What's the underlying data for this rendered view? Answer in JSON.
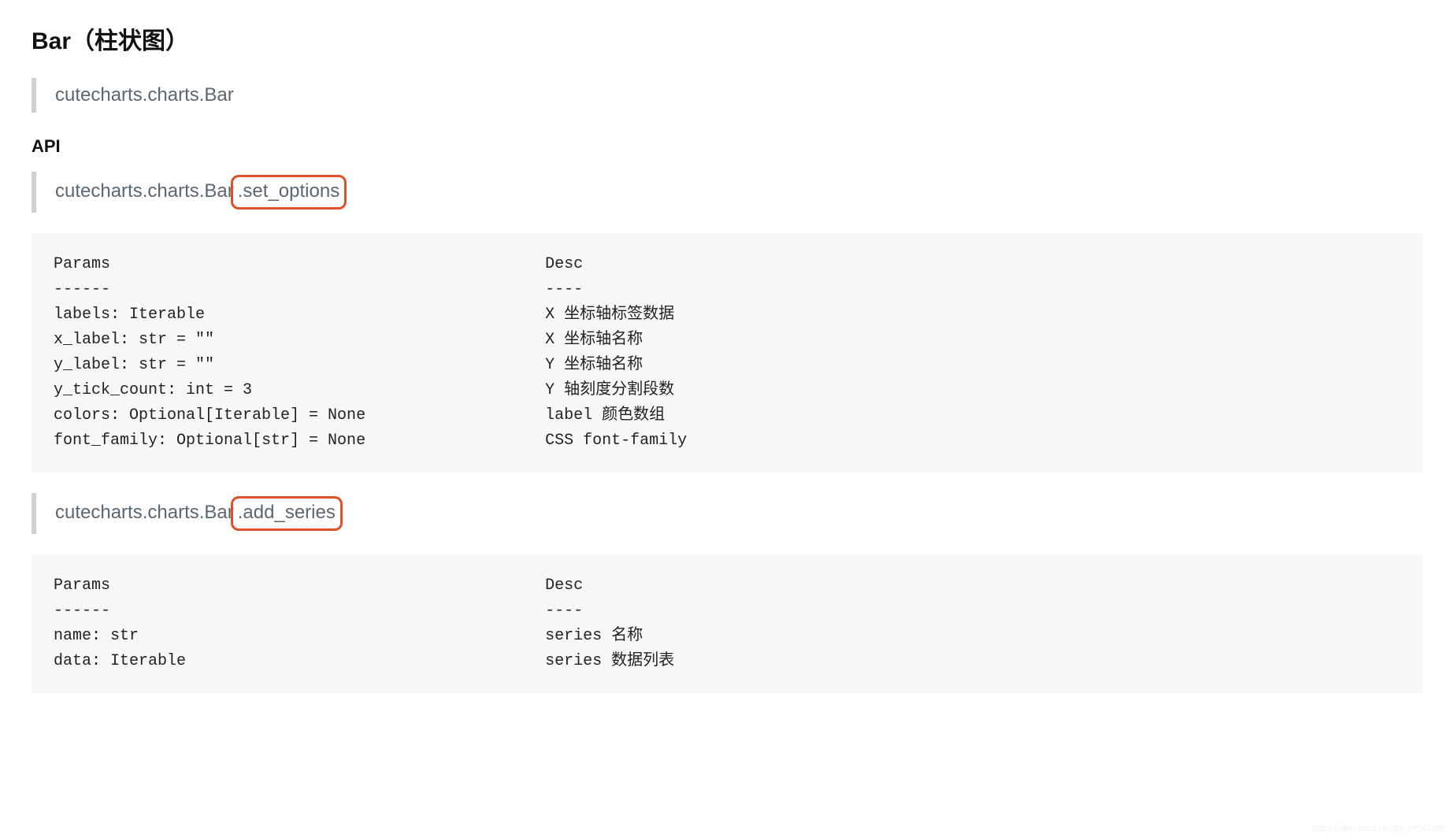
{
  "title": "Bar（柱状图）",
  "quote_module": "cutecharts.charts.Bar",
  "api_heading": "API",
  "method1": {
    "prefix": "cutecharts.charts.Bar",
    "suffix": ".set_options",
    "code": "Params                                              Desc\n------                                              ----\nlabels: Iterable                                    X 坐标轴标签数据\nx_label: str = \"\"                                   X 坐标轴名称\ny_label: str = \"\"                                   Y 坐标轴名称\ny_tick_count: int = 3                               Y 轴刻度分割段数\ncolors: Optional[Iterable] = None                   label 颜色数组\nfont_family: Optional[str] = None                   CSS font-family"
  },
  "method2": {
    "prefix": "cutecharts.charts.Bar",
    "suffix": ".add_series",
    "code": "Params                                              Desc\n------                                              ----\nname: str                                           series 名称\ndata: Iterable                                      series 数据列表"
  },
  "watermark": "https://blog.csdn.net/qq_39241986"
}
